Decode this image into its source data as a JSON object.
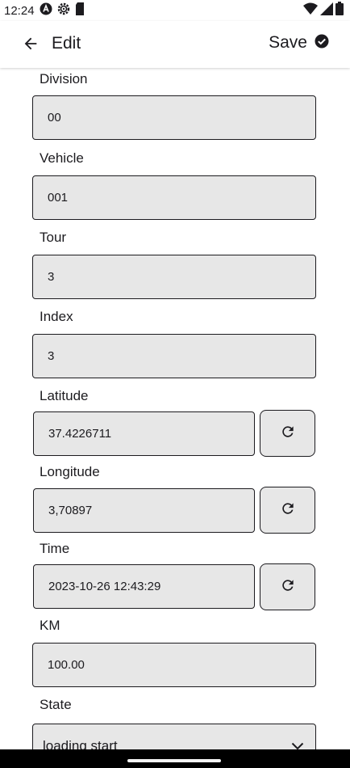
{
  "status_bar": {
    "time": "12:24",
    "icons_left": [
      "a-badge-icon",
      "settings-gear-icon",
      "sd-card-icon"
    ],
    "icons_right": [
      "wifi-icon",
      "cell-signal-icon",
      "battery-icon"
    ]
  },
  "appbar": {
    "title": "Edit",
    "save_label": "Save",
    "back_icon": "arrow-left-icon",
    "save_icon": "check-circle-icon"
  },
  "form": {
    "division": {
      "label": "Division",
      "value": "00"
    },
    "vehicle": {
      "label": "Vehicle",
      "value": "001"
    },
    "tour": {
      "label": "Tour",
      "value": "3"
    },
    "index": {
      "label": "Index",
      "value": "3"
    },
    "latitude": {
      "label": "Latitude",
      "value": "37.4226711"
    },
    "longitude": {
      "label": "Longitude",
      "value": "3,70897"
    },
    "time": {
      "label": "Time",
      "value": "2023-10-26 12:43:29"
    },
    "km": {
      "label": "KM",
      "value": "100.00"
    },
    "state": {
      "label": "State",
      "value": "loading start"
    }
  },
  "colors": {
    "field_bg": "#e7e7e7",
    "text": "#1c1b1f",
    "nav_bar": "#000000"
  }
}
